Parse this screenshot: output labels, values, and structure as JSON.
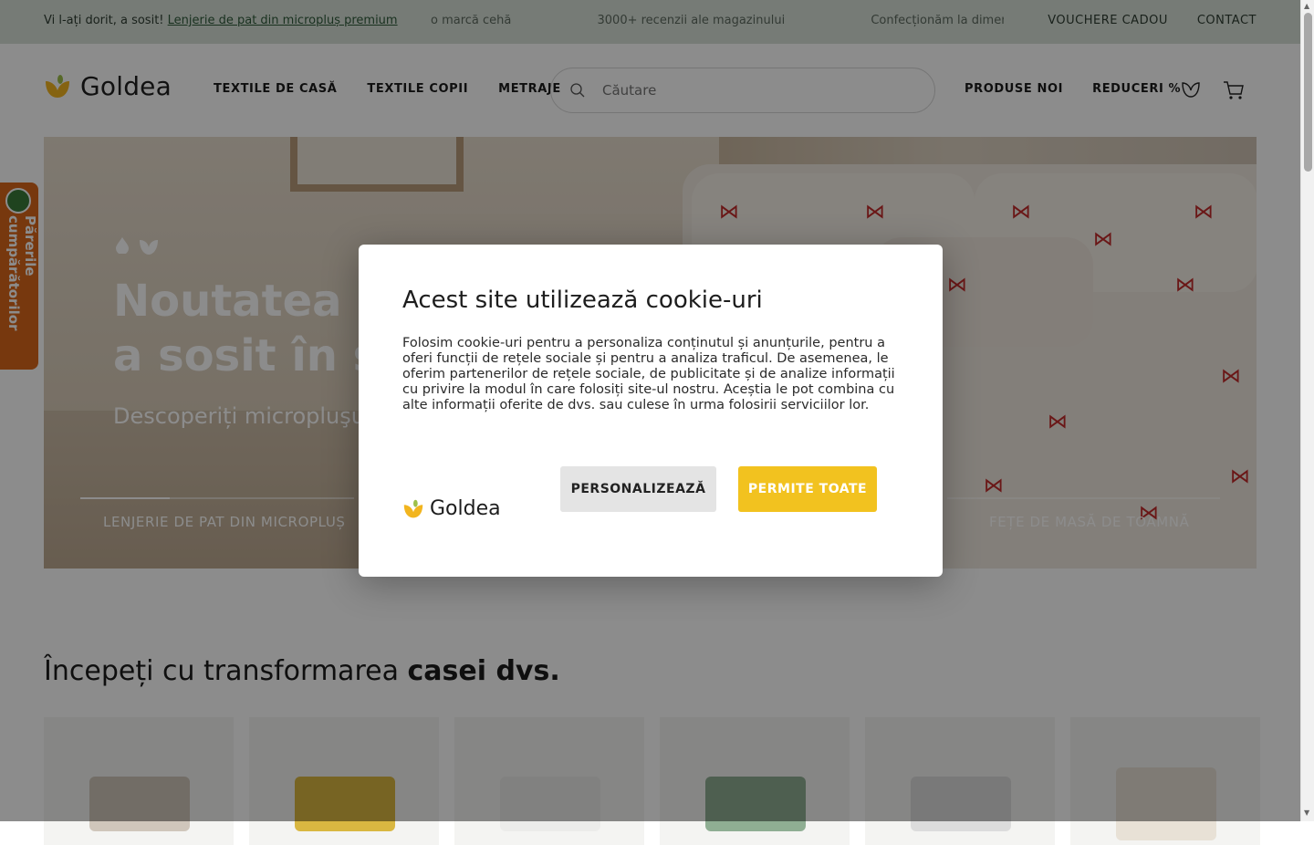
{
  "topbar": {
    "promo_prefix": "Vi l-ați dorit, a sosit! ",
    "promo_link": "Lenjerie de pat din micropluș premium",
    "ticker": [
      "o marcă cehă",
      "3000+ recenzii ale magazinului",
      "Confecționăm la dimensiu"
    ],
    "vouchers": "VOUCHERE CADOU",
    "contact": "CONTACT"
  },
  "header": {
    "logo_text": "Goldea",
    "nav": [
      "TEXTILE DE CASĂ",
      "TEXTILE COPII",
      "METRAJE"
    ],
    "search_placeholder": "Căutare",
    "new_products": "PRODUSE NOI",
    "discounts": "REDUCERI %"
  },
  "hero": {
    "title": "Noutatea că a sosit în sfâ",
    "title_line1": "Noutatea că",
    "title_line2": "a sosit în sfâ",
    "subtitle": "Descoperiți micropluşu",
    "tab_left": "LENJERIE DE PAT DIN MICROPLUȘ",
    "tab_right": "FEȚE DE MASĂ DE TOAMNĂ"
  },
  "reviews_tab": {
    "label": "Părerile cumpărătorilor"
  },
  "section": {
    "title_normal": "Începeți cu transformarea ",
    "title_bold": "casei dvs."
  },
  "cookie_modal": {
    "title": "Acest site utilizează cookie-uri",
    "body": "Folosim cookie-uri pentru a personaliza conținutul și anunțurile, pentru a oferi funcții de rețele sociale și pentru a analiza traficul. De asemenea, le oferim partenerilor de rețele sociale, de publicitate și de analize informații cu privire la modul în care folosiți site-ul nostru. Aceștia le pot combina cu alte informații oferite de dvs. sau culese în urma folosirii serviciilor lor.",
    "logo_text": "Goldea",
    "customize": "PERSONALIZEAZĂ",
    "accept_all": "PERMITE TOATE"
  },
  "colors": {
    "accent": "#f2c21f",
    "topbar": "#d7e0d8",
    "reviews": "#d9661a"
  }
}
